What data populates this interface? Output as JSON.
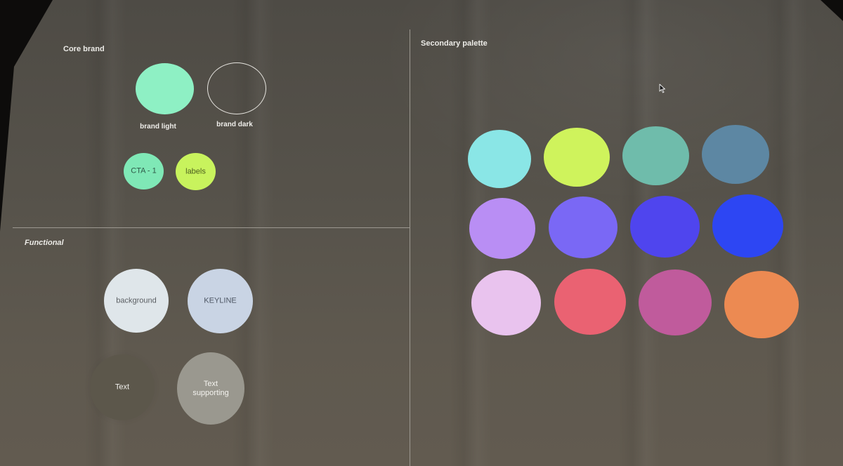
{
  "core_brand": {
    "title": "Core brand",
    "swatches": [
      {
        "label": "brand light",
        "color": "#8ef0c4"
      },
      {
        "label": "brand dark",
        "color": "transparent",
        "outline": "#e6e4df"
      },
      {
        "label": "CTA - 1",
        "color": "#7fe8b6"
      },
      {
        "label": "labels",
        "color": "#c8f35d"
      }
    ]
  },
  "functional": {
    "title": "Functional",
    "swatches": [
      {
        "label": "background",
        "color": "#dfe6ea"
      },
      {
        "label": "KEYLINE",
        "color": "#c9d4e4"
      },
      {
        "label": "Text",
        "color": "#5c574b"
      },
      {
        "label_line1": "Text",
        "label_line2": "supporting",
        "color": "#9a988f"
      }
    ]
  },
  "secondary_palette": {
    "title": "Secondary palette",
    "colors": [
      "#8ae6e6",
      "#cff35c",
      "#6fbcab",
      "#5d87a3",
      "#b98ef4",
      "#7a68f5",
      "#4f45ee",
      "#2d46f3",
      "#e9c3ee",
      "#ea6272",
      "#c05b9c",
      "#ec8a52"
    ]
  }
}
